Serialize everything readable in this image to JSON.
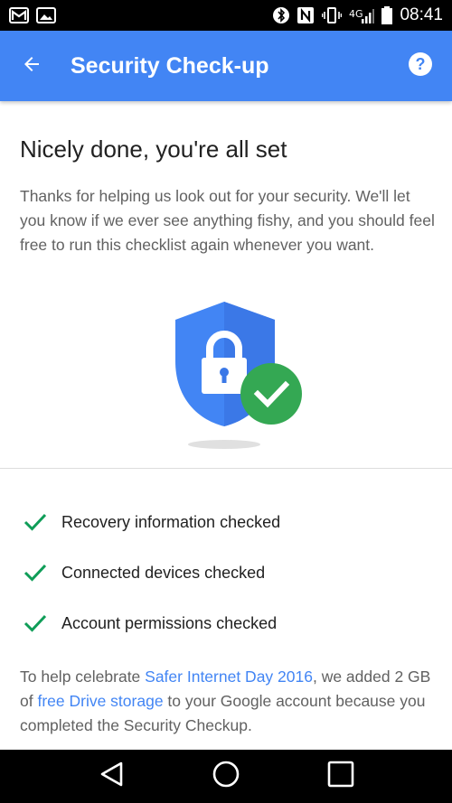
{
  "status_bar": {
    "time": "08:41",
    "left_icons": [
      "gmail-notification-icon",
      "image-notification-icon"
    ],
    "right_icons": [
      "bluetooth-icon",
      "nfc-icon",
      "vibrate-icon",
      "signal-icon",
      "battery-icon"
    ]
  },
  "app_bar": {
    "title": "Security Check-up",
    "back_icon": "arrow-back-icon",
    "help_icon": "help-icon",
    "color": "#4285f4"
  },
  "main": {
    "heading": "Nicely done, you're all set",
    "intro": "Thanks for helping us look out for your security. We'll let you know if we ever see anything fishy, and you should feel free to run this checklist again whenever you want.",
    "illustration": "shield-lock-check-icon",
    "checklist": [
      {
        "label": "Recovery information checked",
        "icon": "check-icon"
      },
      {
        "label": "Connected devices checked",
        "icon": "check-icon"
      },
      {
        "label": "Account permissions checked",
        "icon": "check-icon"
      }
    ],
    "footer": {
      "part1": "To help celebrate ",
      "link1": "Safer Internet Day 2016",
      "part2": ", we added 2 GB of ",
      "link2": "free Drive storage",
      "part3": " to your Google account because you completed the Security Checkup."
    }
  },
  "colors": {
    "accent": "#4285f4",
    "success": "#34a853",
    "check": "#0f9d58"
  },
  "nav_bar": {
    "buttons": [
      "back-triangle-icon",
      "home-circle-icon",
      "recents-square-icon"
    ]
  }
}
